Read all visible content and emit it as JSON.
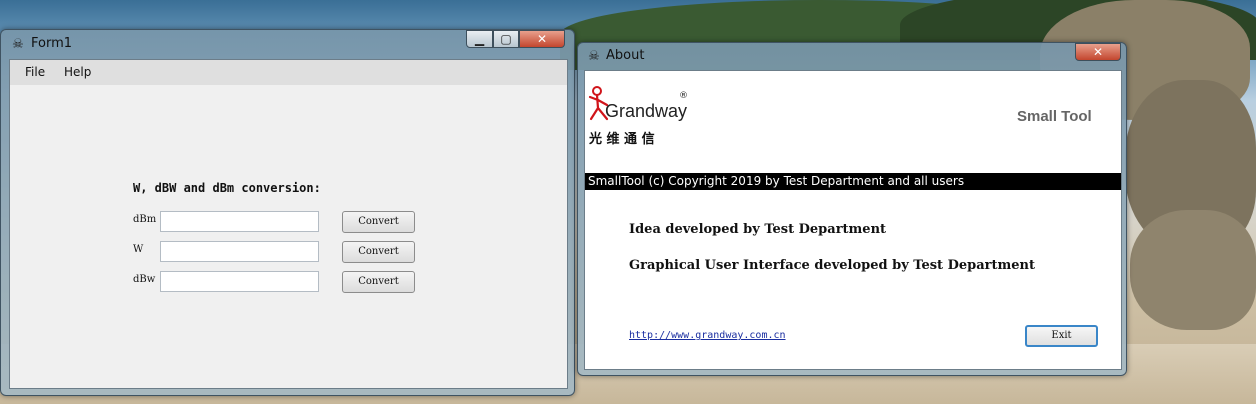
{
  "form1": {
    "title": "Form1",
    "icon": "skull-icon",
    "window_controls": {
      "minimize": "▁",
      "maximize": "▢",
      "close": "✕"
    },
    "menu": [
      {
        "label": "File"
      },
      {
        "label": "Help"
      }
    ],
    "heading": "W, dBW and dBm conversion:",
    "rows": [
      {
        "label": "dBm",
        "value": "",
        "button": "Convert"
      },
      {
        "label": "W",
        "value": "",
        "button": "Convert"
      },
      {
        "label": "dBw",
        "value": "",
        "button": "Convert"
      }
    ]
  },
  "about": {
    "title": "About",
    "icon": "skull-icon",
    "close_glyph": "✕",
    "logo": {
      "brand": "Grandway",
      "registered": "®",
      "chinese": "光 维 通 信",
      "color": "#d0141a"
    },
    "app_name": "Small Tool",
    "banner": "SmallTool (c) Copyright 2019 by Test Department and all users",
    "lines": [
      "Idea developed by Test Department",
      "Graphical User Interface developed by Test Department"
    ],
    "link": "http://www.grandway.com.cn",
    "exit_label": "Exit"
  }
}
